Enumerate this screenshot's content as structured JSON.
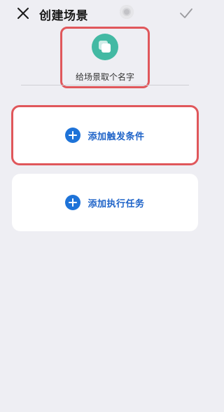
{
  "header": {
    "title": "创建场景",
    "close_icon": "close-icon",
    "confirm_icon": "check-icon"
  },
  "scene": {
    "icon": "scene-icon",
    "icon_color": "#43b9a3",
    "name_placeholder": "给场景取个名字"
  },
  "cards": {
    "trigger_label": "添加触发条件",
    "task_label": "添加执行任务",
    "accent_color": "#1e73d8"
  },
  "colors": {
    "highlight": "#e0575b",
    "background": "#eeeef3"
  }
}
